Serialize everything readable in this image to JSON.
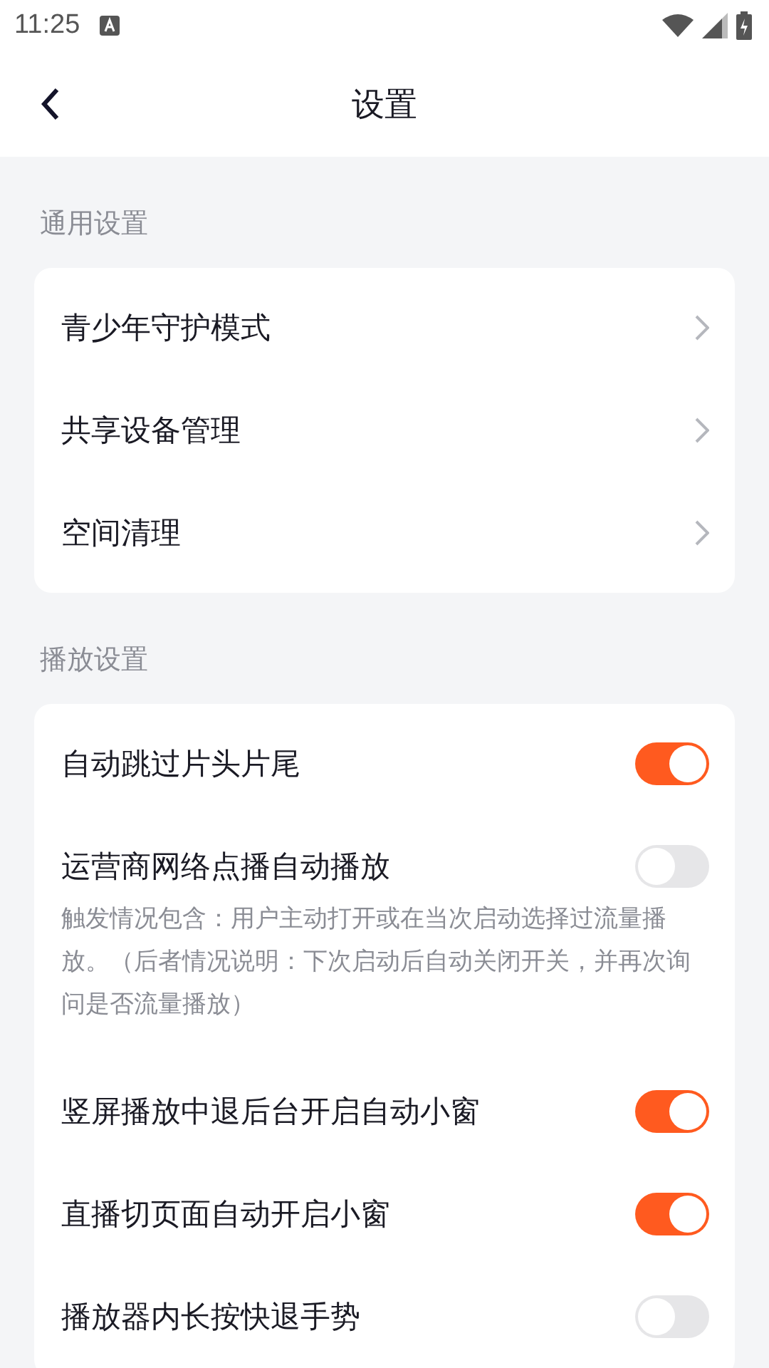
{
  "status_bar": {
    "time": "11:25"
  },
  "header": {
    "title": "设置"
  },
  "sections": [
    {
      "title": "通用设置",
      "items": [
        {
          "kind": "link",
          "label": "青少年守护模式"
        },
        {
          "kind": "link",
          "label": "共享设备管理"
        },
        {
          "kind": "link",
          "label": "空间清理"
        }
      ]
    },
    {
      "title": "播放设置",
      "items": [
        {
          "kind": "toggle",
          "label": "自动跳过片头片尾",
          "on": true
        },
        {
          "kind": "toggle",
          "label": "运营商网络点播自动播放",
          "on": false,
          "note": "触发情况包含：用户主动打开或在当次启动选择过流量播放。（后者情况说明：下次启动后自动关闭开关，并再次询问是否流量播放）"
        },
        {
          "kind": "toggle",
          "label": "竖屏播放中退后台开启自动小窗",
          "on": true
        },
        {
          "kind": "toggle",
          "label": "直播切页面自动开启小窗",
          "on": true
        },
        {
          "kind": "toggle",
          "label": "播放器内长按快退手势",
          "on": false
        }
      ]
    }
  ]
}
